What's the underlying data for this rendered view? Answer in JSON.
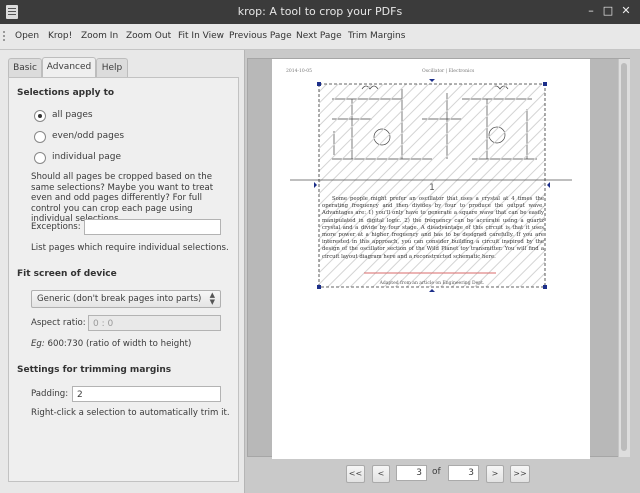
{
  "window": {
    "title": "krop: A tool to crop your PDFs"
  },
  "toolbar": {
    "open": "Open",
    "krop": "Krop!",
    "zoom_in": "Zoom In",
    "zoom_out": "Zoom Out",
    "fit_in_view": "Fit In View",
    "previous_page": "Previous Page",
    "next_page": "Next Page",
    "trim_margins": "Trim Margins"
  },
  "tabs": {
    "basic": "Basic",
    "advanced": "Advanced",
    "help": "Help"
  },
  "selections": {
    "heading": "Selections apply to",
    "all_pages": "all pages",
    "even_odd": "even/odd pages",
    "individual": "individual page",
    "description": "Should all pages be cropped based on the same selections? Maybe you want to treat even and odd pages differently? For full control you can crop each page using individual selections.",
    "exceptions_label": "Exceptions:",
    "exceptions_value": "",
    "exceptions_hint": "List pages which require individual selections."
  },
  "fit_screen": {
    "heading": "Fit screen of device",
    "device": "Generic (don't break pages into parts)",
    "aspect_label": "Aspect ratio:",
    "aspect_placeholder": "0 : 0",
    "example_prefix": "Eg:",
    "example_text": " 600:730 (ratio of width to height)"
  },
  "trimming": {
    "heading": "Settings for trimming margins",
    "padding_label": "Padding:",
    "padding_value": "2",
    "hint": "Right-click a selection to automatically trim it."
  },
  "pdf_page": {
    "header_left": "2014-10-05",
    "header_center": "Oscillator | Electronics",
    "number": "1",
    "body": "Some people might prefer an oscillator that uses a crystal at 4 times the operating frequency and then divides by four to produce the output wave. Advantages are: 1) you'll only have to generate a square wave that can be easily manipulated in digital logic. 2) the frequency can be accurate using a quartz crystal and a divide by four stage. A disadvantage of this circuit is that it uses more power at a higher frequency and has to be designed carefully. If you are interested in this approach, you can consider building a circuit inspired by the design of the oscillator section of the Wild Planet toy transmitter. You will find a circuit layout diagram here and a reconstructed schematic here.",
    "footer_link": "Adapted from an article on Engineering Dept."
  },
  "pagination": {
    "first": "<<",
    "prev": "<",
    "current": "3",
    "of": "of",
    "total": "3",
    "next": ">",
    "last": ">>"
  }
}
